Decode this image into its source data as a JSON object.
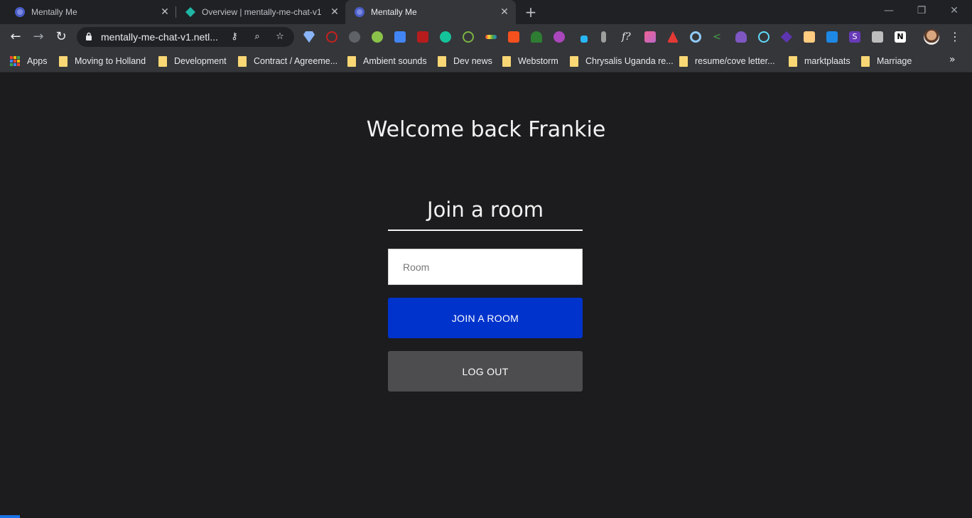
{
  "tabs": [
    {
      "title": "Mentally Me",
      "active": false
    },
    {
      "title": "Overview | mentally-me-chat-v1",
      "active": false
    },
    {
      "title": "Mentally Me",
      "active": true
    }
  ],
  "address_bar": {
    "url": "mentally-me-chat-v1.netl..."
  },
  "bookmarks": [
    {
      "label": "Apps",
      "icon": "apps-grid-icon"
    },
    {
      "label": "Moving to Holland",
      "icon": "folder-icon"
    },
    {
      "label": "Development",
      "icon": "folder-icon"
    },
    {
      "label": "Contract / Agreeme...",
      "icon": "folder-icon"
    },
    {
      "label": "Ambient sounds",
      "icon": "folder-icon"
    },
    {
      "label": "Dev news",
      "icon": "folder-icon"
    },
    {
      "label": "Webstorm",
      "icon": "folder-icon"
    },
    {
      "label": "Chrysalis Uganda re...",
      "icon": "folder-icon"
    },
    {
      "label": "resume/cove letter...",
      "icon": "folder-icon"
    },
    {
      "label": "marktplaats",
      "icon": "folder-icon"
    },
    {
      "label": "Marriage",
      "icon": "folder-icon"
    }
  ],
  "page": {
    "welcome": "Welcome back Frankie",
    "join_heading": "Join a room",
    "room_placeholder": "Room",
    "join_button": "JOIN A ROOM",
    "logout_button": "LOG OUT"
  },
  "colors": {
    "background": "#1c1c1e",
    "join_button": "#0033cc",
    "logout_button": "#4d4d4f"
  }
}
